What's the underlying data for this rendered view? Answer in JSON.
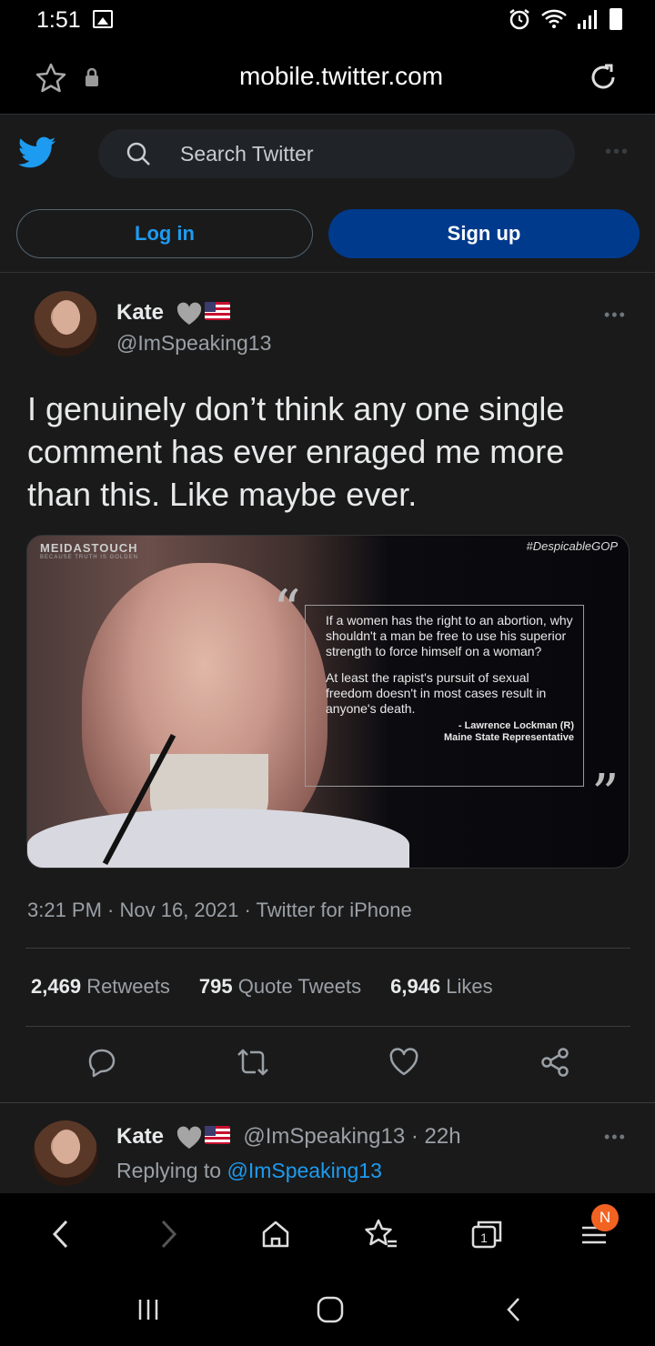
{
  "status_bar": {
    "time": "1:51"
  },
  "browser": {
    "url": "mobile.twitter.com"
  },
  "header": {
    "search_placeholder": "Search Twitter",
    "login_label": "Log in",
    "signup_label": "Sign up"
  },
  "tweet": {
    "author_name": "Kate",
    "author_handle": "@ImSpeaking13",
    "text": "I genuinely don’t think any one single comment has ever enraged me more than this. Like maybe ever.",
    "media": {
      "brand": "MEIDASTOUCH",
      "brand_tagline": "BECAUSE TRUTH IS GOLDEN",
      "hashtag": "#DespicableGOP",
      "quote_p1": "If a women has the right to an abortion, why shouldn't a man be free to use his superior strength to force himself on a woman?",
      "quote_p2": "At least the rapist's pursuit of sexual freedom doesn't in most cases result in anyone's death.",
      "attribution_line1": "- Lawrence Lockman (R)",
      "attribution_line2": "Maine State Representative"
    },
    "timestamp": "3:21 PM · Nov 16, 2021 · Twitter for iPhone",
    "retweets_count": "2,469",
    "retweets_label": "Retweets",
    "quotes_count": "795",
    "quotes_label": "Quote Tweets",
    "likes_count": "6,946",
    "likes_label": "Likes"
  },
  "reply": {
    "author_name": "Kate",
    "author_handle_time": "@ImSpeaking13 · 22h",
    "replying_prefix": "Replying to",
    "replying_to": "@ImSpeaking13"
  },
  "toolbar": {
    "tabs_count": "1",
    "menu_badge": "N"
  },
  "colors": {
    "accent": "#1d9bf0",
    "signup_bg": "#003a8c",
    "badge": "#f26322"
  }
}
